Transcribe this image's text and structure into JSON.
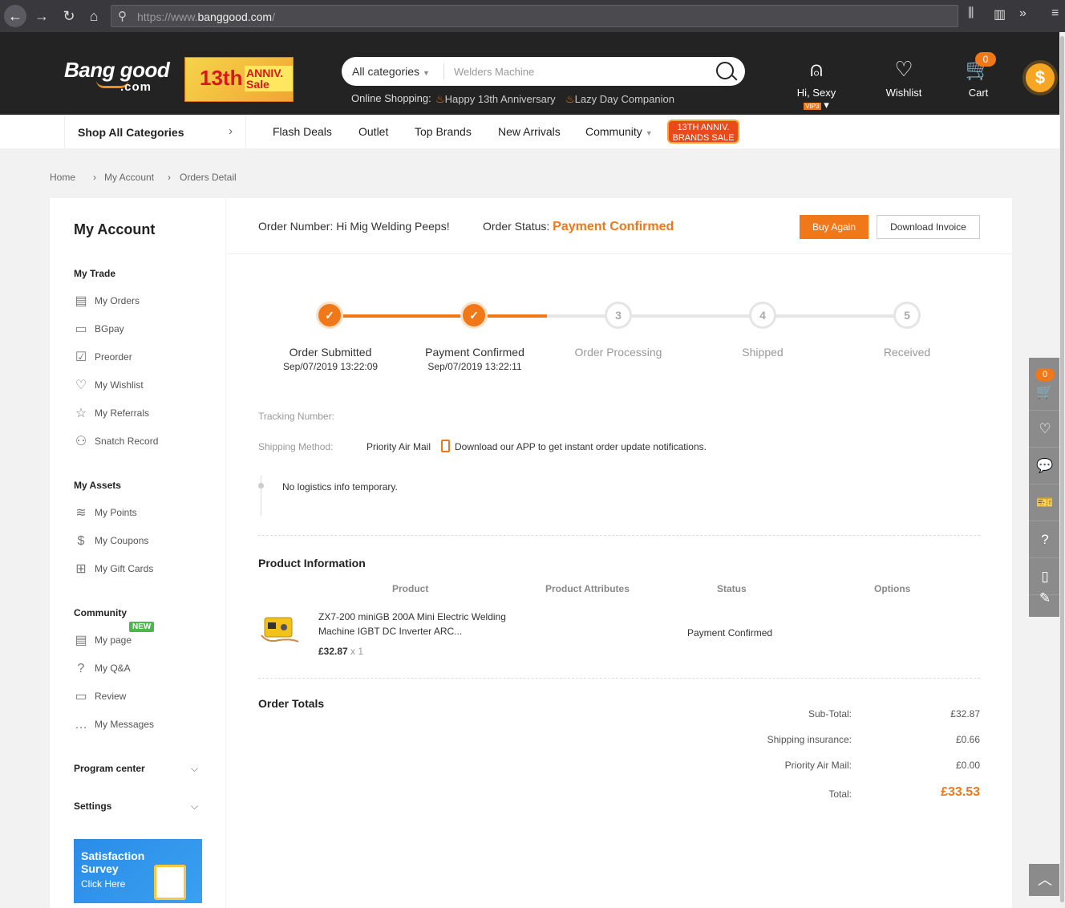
{
  "browser": {
    "url_prefix": "https://www.",
    "url_domain": "banggood.com",
    "url_suffix": "/"
  },
  "header": {
    "logo_top": "Bang good",
    "logo_bottom": ".com",
    "anniv_number": "13th",
    "anniv_text": "ANNIV. Sale",
    "search_category": "All categories",
    "search_placeholder": "Welders Machine",
    "online_label": "Online Shopping:",
    "hot_links": [
      "Happy 13th Anniversary",
      "Lazy Day Companion"
    ],
    "account_label": "Hi, Sexy",
    "wishlist_label": "Wishlist",
    "cart_label": "Cart",
    "cart_count": "0"
  },
  "nav": {
    "shop_all": "Shop All Categories",
    "links": [
      "Flash Deals",
      "Outlet",
      "Top Brands",
      "New Arrivals",
      "Community"
    ],
    "brand_sale": "13TH ANNIV. BRANDS SALE"
  },
  "breadcrumb": [
    "Home",
    "My Account",
    "Orders Detail"
  ],
  "sidebar": {
    "title": "My Account",
    "trade_title": "My Trade",
    "trade": [
      "My Orders",
      "BGpay",
      "Preorder",
      "My Wishlist",
      "My Referrals",
      "Snatch Record"
    ],
    "assets_title": "My Assets",
    "assets": [
      "My Points",
      "My Coupons",
      "My Gift Cards"
    ],
    "community_title": "Community",
    "new_badge": "NEW",
    "community": [
      "My page",
      "My Q&A",
      "Review",
      "My Messages"
    ],
    "program_center": "Program center",
    "settings": "Settings",
    "survey_title": "Satisfaction Survey",
    "survey_cta": "Click Here"
  },
  "order": {
    "number_label": "Order Number:",
    "number_value": "Hi Mig Welding Peeps!",
    "status_label": "Order Status:",
    "status_value": "Payment Confirmed",
    "buy_again": "Buy Again",
    "download_invoice": "Download Invoice",
    "steps": [
      {
        "num": "✓",
        "label": "Order Submitted",
        "date": "Sep/07/2019 13:22:09",
        "done": true
      },
      {
        "num": "✓",
        "label": "Payment Confirmed",
        "date": "Sep/07/2019 13:22:11",
        "done": true
      },
      {
        "num": "3",
        "label": "Order Processing",
        "date": "",
        "done": false
      },
      {
        "num": "4",
        "label": "Shipped",
        "date": "",
        "done": false
      },
      {
        "num": "5",
        "label": "Received",
        "date": "",
        "done": false
      }
    ],
    "tracking_label": "Tracking Number:",
    "shipping_label": "Shipping Method:",
    "shipping_value": "Priority Air Mail",
    "app_notice": "Download our APP to get instant order update notifications.",
    "no_logistics": "No logistics info temporary.",
    "product_info_title": "Product Information",
    "columns": [
      "Product",
      "Product Attributes",
      "Status",
      "Options"
    ],
    "product": {
      "name": "ZX7-200 miniGB 200A Mini Electric Welding Machine IGBT DC Inverter ARC...",
      "price": "£32.87",
      "qty": "x 1",
      "status": "Payment Confirmed"
    },
    "totals_title": "Order Totals",
    "totals": [
      {
        "label": "Sub-Total:",
        "value": "£32.87"
      },
      {
        "label": "Shipping insurance:",
        "value": "£0.66"
      },
      {
        "label": "Priority Air Mail:",
        "value": "£0.00"
      }
    ],
    "total_label": "Total:",
    "total_value": "£33.53"
  },
  "float_bar": {
    "cart_count": "0"
  },
  "colors": {
    "accent": "#f07818",
    "header_bg": "#232323",
    "float_bg": "#8b8b8b"
  }
}
